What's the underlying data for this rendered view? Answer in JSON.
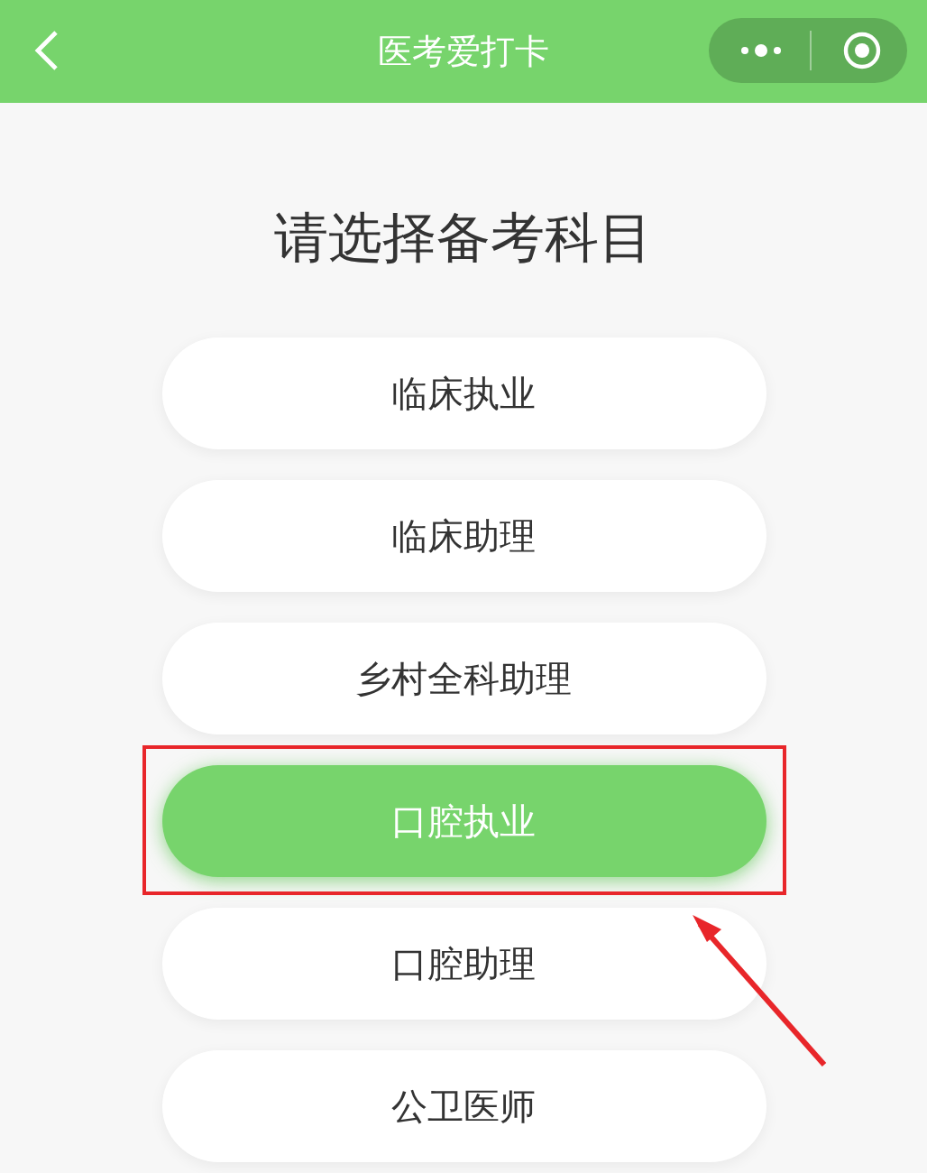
{
  "nav_bar": {
    "title": "医考爱打卡"
  },
  "heading": "请选择备考科目",
  "subjects": [
    {
      "label": "临床执业",
      "selected": false
    },
    {
      "label": "临床助理",
      "selected": false
    },
    {
      "label": "乡村全科助理",
      "selected": false
    },
    {
      "label": "口腔执业",
      "selected": true
    },
    {
      "label": "口腔助理",
      "selected": false
    },
    {
      "label": "公卫医师",
      "selected": false
    }
  ]
}
